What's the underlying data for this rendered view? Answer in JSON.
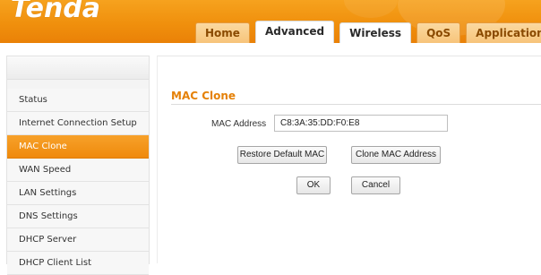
{
  "header": {
    "logo": "Tenda",
    "tabs": [
      {
        "label": "Home"
      },
      {
        "label": "Advanced"
      },
      {
        "label": "Wireless"
      },
      {
        "label": "QoS"
      },
      {
        "label": "Applications"
      }
    ]
  },
  "sidebar": {
    "items": [
      {
        "label": "Status"
      },
      {
        "label": "Internet Connection Setup"
      },
      {
        "label": "MAC Clone"
      },
      {
        "label": "WAN Speed"
      },
      {
        "label": "LAN Settings"
      },
      {
        "label": "DNS Settings"
      },
      {
        "label": "DHCP Server"
      },
      {
        "label": "DHCP Client List"
      }
    ],
    "active_index": 2
  },
  "main": {
    "section_title": "MAC Clone",
    "mac_address_label": "MAC Address",
    "mac_address_value": "C8:3A:35:DD:F0:E8",
    "restore_button": "Restore Default MAC",
    "clone_button": "Clone MAC Address",
    "ok_button": "OK",
    "cancel_button": "Cancel"
  },
  "colors": {
    "accent": "#f08c0c",
    "section_title": "#e58107"
  }
}
